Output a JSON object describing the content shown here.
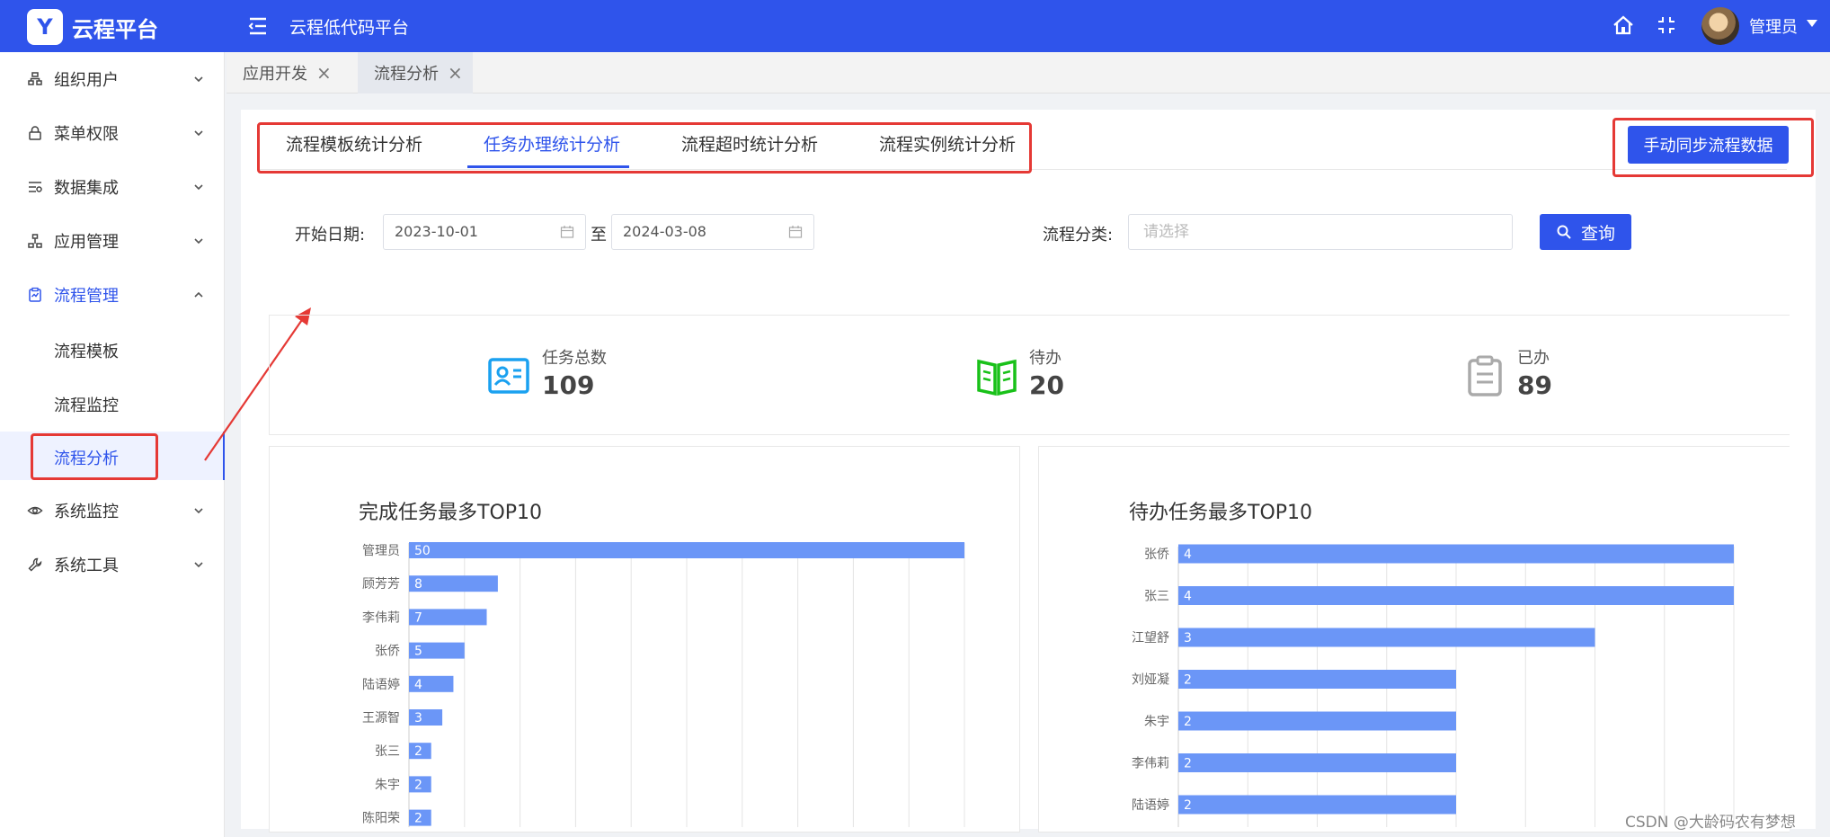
{
  "header": {
    "brand_name": "云程平台",
    "page_title": "云程低代码平台",
    "user_name": "管理员"
  },
  "sidebar": {
    "items": [
      {
        "label": "组织用户",
        "icon": "org-icon"
      },
      {
        "label": "菜单权限",
        "icon": "lock-icon"
      },
      {
        "label": "数据集成",
        "icon": "data-icon"
      },
      {
        "label": "应用管理",
        "icon": "app-icon"
      },
      {
        "label": "流程管理",
        "icon": "flow-icon"
      },
      {
        "label": "流程模板"
      },
      {
        "label": "流程监控"
      },
      {
        "label": "流程分析"
      },
      {
        "label": "系统监控",
        "icon": "eye-icon"
      },
      {
        "label": "系统工具",
        "icon": "wrench-icon"
      }
    ]
  },
  "page_tabs": [
    {
      "label": "应用开发"
    },
    {
      "label": "流程分析"
    }
  ],
  "analysis_tabs": [
    "流程模板统计分析",
    "任务办理统计分析",
    "流程超时统计分析",
    "流程实例统计分析"
  ],
  "sync_button": "手动同步流程数据",
  "filters": {
    "start_label": "开始日期:",
    "start_date": "2023-10-01",
    "separator": "至",
    "end_date": "2024-03-08",
    "category_label": "流程分类:",
    "category_placeholder": "请选择",
    "query_button": "查询"
  },
  "stats": [
    {
      "label": "任务总数",
      "value": "109"
    },
    {
      "label": "待办",
      "value": "20"
    },
    {
      "label": "已办",
      "value": "89"
    }
  ],
  "chart_data": [
    {
      "type": "bar",
      "title": "完成任务最多TOP10",
      "categories": [
        "管理员",
        "顾芳芳",
        "李伟莉",
        "张侨",
        "陆语婷",
        "王源智",
        "张三",
        "朱宇",
        "陈阳荣"
      ],
      "values": [
        50,
        8,
        7,
        5,
        4,
        3,
        2,
        2,
        2
      ],
      "xlim": [
        0,
        50
      ],
      "grid": true
    },
    {
      "type": "bar",
      "title": "待办任务最多TOP10",
      "categories": [
        "张侨",
        "张三",
        "江望舒",
        "刘娅凝",
        "朱宇",
        "李伟莉",
        "陆语婷"
      ],
      "values": [
        4,
        4,
        3,
        2,
        2,
        2,
        2
      ],
      "xlim": [
        0,
        4
      ],
      "grid": true
    }
  ],
  "watermark": "CSDN @大龄码农有梦想",
  "colors": {
    "primary": "#2f54eb",
    "bar": "#6b96f7",
    "highlight_red": "#e53935"
  }
}
